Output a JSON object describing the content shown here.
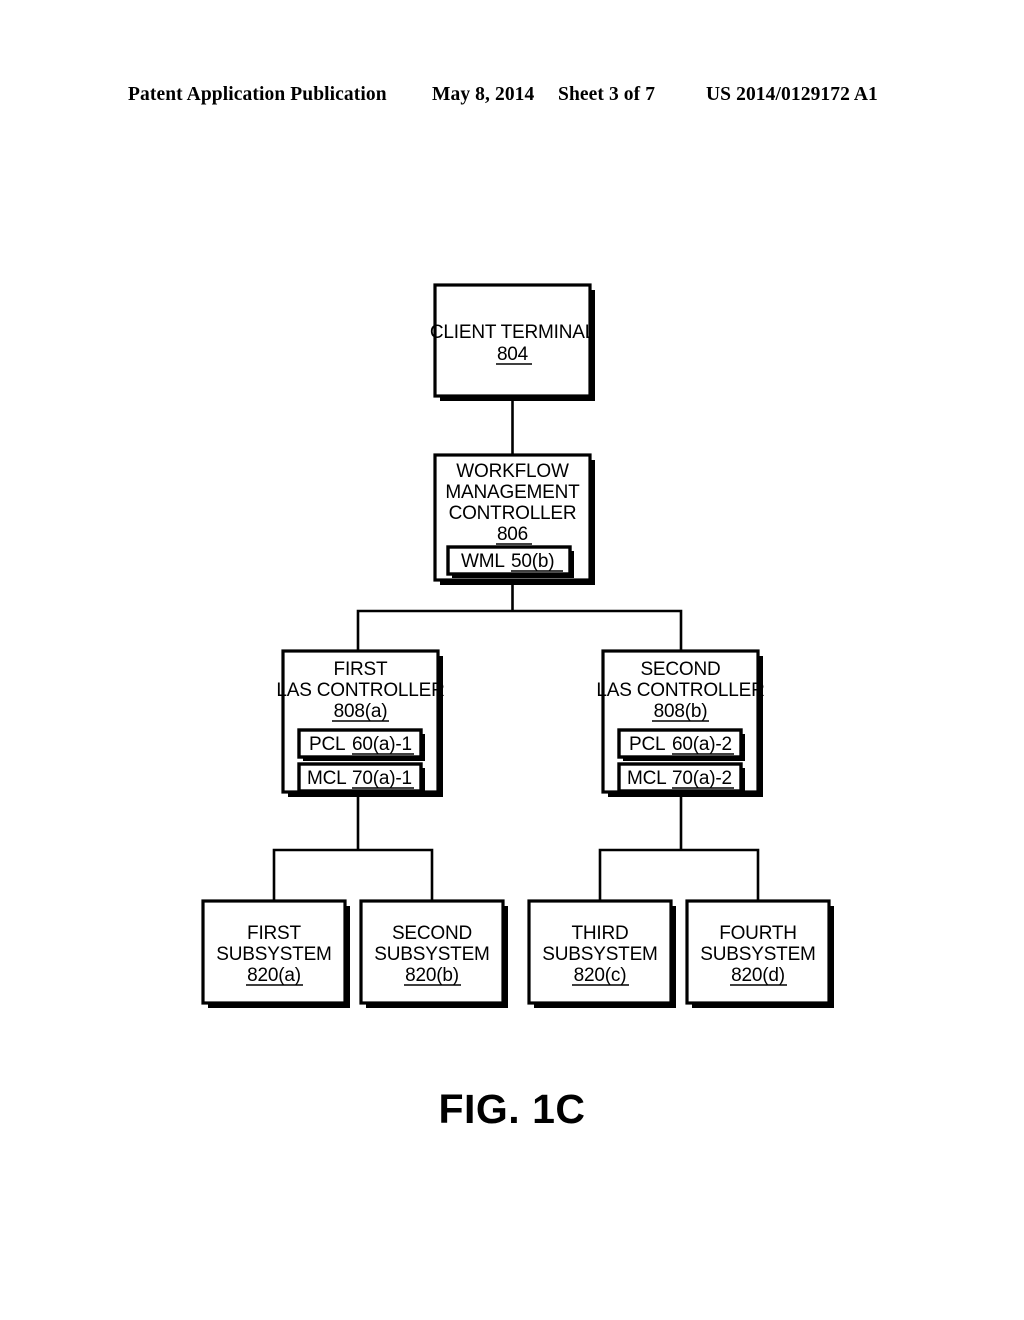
{
  "header": {
    "publication": "Patent Application Publication",
    "date": "May 8, 2014",
    "sheet": "Sheet 3 of 7",
    "patent_number": "US 2014/0129172 A1"
  },
  "figure": {
    "caption": "FIG. 1C"
  },
  "diagram": {
    "type": "block-diagram",
    "nodes": {
      "client_terminal": {
        "lines": [
          "CLIENT TERMINAL"
        ],
        "ref": "804"
      },
      "workflow_management_controller": {
        "lines": [
          "WORKFLOW",
          "MANAGEMENT",
          "CONTROLLER"
        ],
        "ref": "806",
        "inner": [
          {
            "label": "WML",
            "ref": "50(b)"
          }
        ]
      },
      "first_las_controller": {
        "lines": [
          "FIRST",
          "LAS CONTROLLER"
        ],
        "ref": "808(a)",
        "inner": [
          {
            "label": "PCL",
            "ref": "60(a)-1"
          },
          {
            "label": "MCL",
            "ref": "70(a)-1"
          }
        ]
      },
      "second_las_controller": {
        "lines": [
          "SECOND",
          "LAS CONTROLLER"
        ],
        "ref": "808(b)",
        "inner": [
          {
            "label": "PCL",
            "ref": "60(a)-2"
          },
          {
            "label": "MCL",
            "ref": "70(a)-2"
          }
        ]
      },
      "first_subsystem": {
        "lines": [
          "FIRST",
          "SUBSYSTEM"
        ],
        "ref": "820(a)"
      },
      "second_subsystem": {
        "lines": [
          "SECOND",
          "SUBSYSTEM"
        ],
        "ref": "820(b)"
      },
      "third_subsystem": {
        "lines": [
          "THIRD",
          "SUBSYSTEM"
        ],
        "ref": "820(c)"
      },
      "fourth_subsystem": {
        "lines": [
          "FOURTH",
          "SUBSYSTEM"
        ],
        "ref": "820(d)"
      }
    },
    "edges": [
      {
        "from": "client_terminal",
        "to": "workflow_management_controller"
      },
      {
        "from": "workflow_management_controller",
        "to": "first_las_controller"
      },
      {
        "from": "workflow_management_controller",
        "to": "second_las_controller"
      },
      {
        "from": "first_las_controller",
        "to": "first_subsystem"
      },
      {
        "from": "first_las_controller",
        "to": "second_subsystem"
      },
      {
        "from": "second_las_controller",
        "to": "third_subsystem"
      },
      {
        "from": "second_las_controller",
        "to": "fourth_subsystem"
      }
    ]
  },
  "colors": {
    "ink": "#000000",
    "paper": "#ffffff"
  }
}
